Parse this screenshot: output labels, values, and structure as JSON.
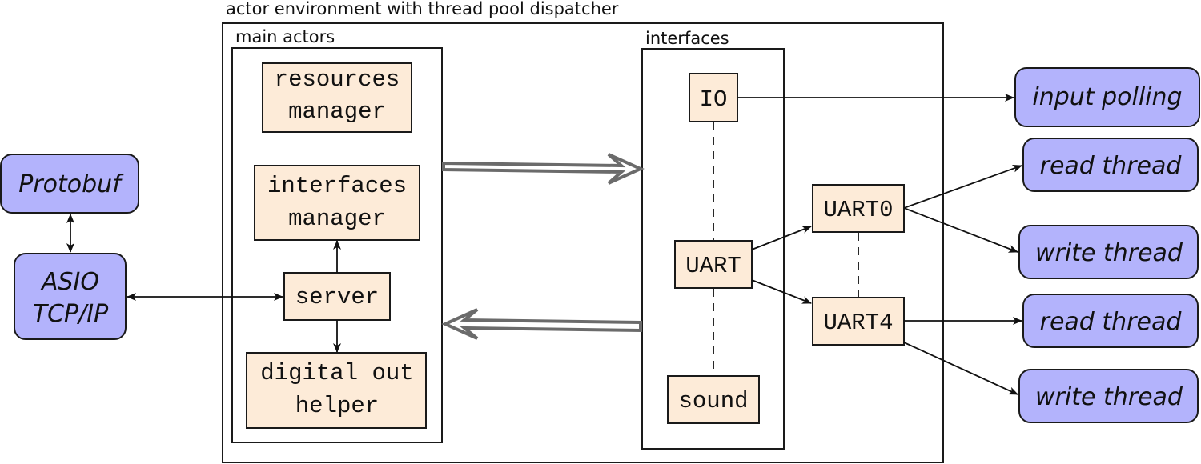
{
  "diagram": {
    "outer_container": {
      "label": "actor environment with thread pool dispatcher"
    },
    "main_actors": {
      "label": "main actors",
      "resources_manager": [
        "resources",
        "manager"
      ],
      "interfaces_manager": [
        "interfaces",
        "manager"
      ],
      "server": "server",
      "digital_out_helper": [
        "digital out",
        "helper"
      ]
    },
    "interfaces": {
      "label": "interfaces",
      "io": "IO",
      "uart": "UART",
      "sound": "sound"
    },
    "uart_ports": {
      "uart0": "UART0",
      "uart4": "UART4"
    },
    "external": {
      "protobuf": "Protobuf",
      "asio": [
        "ASIO",
        "TCP/IP"
      ],
      "input_polling": "input polling",
      "uart0_read": "read thread",
      "uart0_write": "write thread",
      "uart4_read": "read thread",
      "uart4_write": "write thread"
    },
    "colors": {
      "actor_fill": "#fdebd8",
      "external_fill": "#b3b3fc",
      "big_arrow_stroke": "#6b6b6b"
    }
  }
}
